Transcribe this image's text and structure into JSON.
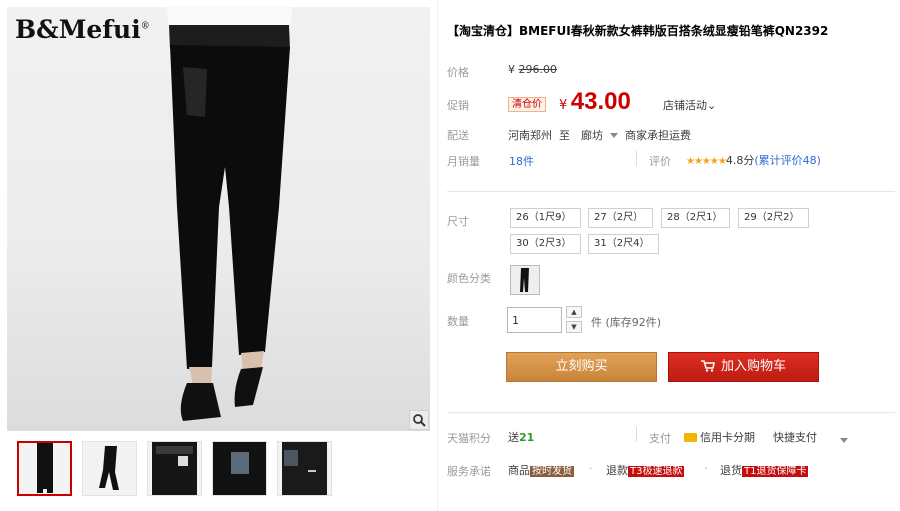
{
  "gallery": {
    "brand": "B&Mefui",
    "brand_mark": "®",
    "thumbnail_count": 5
  },
  "product": {
    "title": "【淘宝清仓】BMEFUI春秋新款女裤韩版百搭条绒显瘦铅笔裤QN2392"
  },
  "price": {
    "label": "价格",
    "currency": "¥",
    "original": "296.00"
  },
  "promo": {
    "label": "促销",
    "tag": "清仓价",
    "currency": "¥",
    "price": "43.00",
    "activity": "店铺活动",
    "activity_chevron": "⌄"
  },
  "delivery": {
    "label": "配送",
    "from": "河南郑州",
    "to_word": "至",
    "to": "廊坊",
    "method": "商家承担运费"
  },
  "sales": {
    "label": "月销量",
    "count": "18件",
    "rating_label": "评价",
    "stars": "★★★★★",
    "score": "4.8分",
    "reviews": "(累计评价48)"
  },
  "options": {
    "size_label": "尺寸",
    "sizes": [
      "26（1尺9）",
      "27（2尺）",
      "28（2尺1）",
      "29（2尺2）",
      "30（2尺3）",
      "31（2尺4）"
    ],
    "color_label": "颜色分类"
  },
  "quantity": {
    "label": "数量",
    "value": "1",
    "unit_stock": "件 (库存92件)"
  },
  "actions": {
    "buy_now": "立刻购买",
    "add_to_cart": "加入购物车"
  },
  "extras": {
    "points_label": "天猫积分",
    "points_prefix": "送",
    "points_value": "21",
    "pay_label": "支付",
    "credit_card": "信用卡分期",
    "quick_pay": "快捷支付",
    "service_label": "服务承诺",
    "service_1_text": "商品",
    "service_1_badge": "按时发货",
    "service_2_text": "退款",
    "service_2_badge": "T3极速退款",
    "service_3_text": "退货",
    "service_3_badge": "T1退货保障卡"
  },
  "colors": {
    "price_red": "#cc0000",
    "buy_button": "#d08c3e",
    "cart_button": "#cc2418",
    "link_blue": "#2f6ad4"
  }
}
